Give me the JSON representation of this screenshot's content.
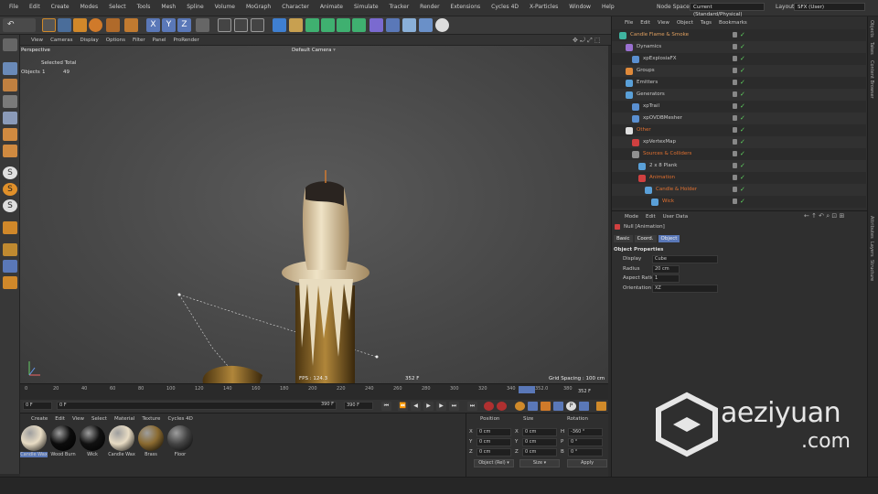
{
  "menu": [
    "File",
    "Edit",
    "Create",
    "Modes",
    "Select",
    "Tools",
    "Mesh",
    "Spline",
    "Volume",
    "MoGraph",
    "Character",
    "Animate",
    "Simulate",
    "Tracker",
    "Render",
    "Extensions",
    "Cycles 4D",
    "X-Particles",
    "Window",
    "Help"
  ],
  "node_space": {
    "label": "Node Space:",
    "value": "Current (Standard/Physical)"
  },
  "layout": {
    "label": "Layout:",
    "value": "SFX (User)"
  },
  "viewport": {
    "menu": [
      "View",
      "Cameras",
      "Display",
      "Options",
      "Filter",
      "Panel",
      "ProRender"
    ],
    "name": "Perspective",
    "camera": "Default Camera",
    "stats": {
      "header": "Selected Total",
      "row_label": "Objects",
      "selected": "1",
      "total": "49"
    },
    "fps": "FPS : 124.3",
    "frame": "352 F",
    "grid": "Grid Spacing : 100 cm"
  },
  "timeline": {
    "ticks": [
      "0",
      "20",
      "40",
      "60",
      "80",
      "100",
      "120",
      "140",
      "160",
      "180",
      "200",
      "220",
      "240",
      "260",
      "280",
      "300",
      "320",
      "340",
      "352.0",
      "380"
    ],
    "end_label": "352 F",
    "current": "352.0"
  },
  "transport": {
    "start": "0 F",
    "start2": "0 F",
    "end": "390 F",
    "end2": "390 F"
  },
  "materials": {
    "menu": [
      "Create",
      "Edit",
      "View",
      "Select",
      "Material",
      "Texture",
      "Cycles 4D"
    ],
    "items": [
      {
        "name": "Candle Wax",
        "color": "#e8dcc4"
      },
      {
        "name": "Wood Burn",
        "color": "#0c0c0c"
      },
      {
        "name": "Wick",
        "color": "#111111"
      },
      {
        "name": "Candle Wax",
        "color": "#e8dcc4"
      },
      {
        "name": "Brass",
        "color": "#8a6a30"
      },
      {
        "name": "Floor",
        "color": "#444444"
      }
    ]
  },
  "coords": {
    "headers": [
      "Position",
      "Size",
      "Rotation"
    ],
    "rows": [
      {
        "a": "X",
        "av": "0 cm",
        "b": "X",
        "bv": "0 cm",
        "c": "H",
        "cv": "-360 °"
      },
      {
        "a": "Y",
        "av": "0 cm",
        "b": "Y",
        "bv": "0 cm",
        "c": "P",
        "cv": "0 °"
      },
      {
        "a": "Z",
        "av": "0 cm",
        "b": "Z",
        "bv": "0 cm",
        "c": "B",
        "cv": "0 °"
      }
    ],
    "mode": "Object (Rel)",
    "size_mode": "Size",
    "apply": "Apply"
  },
  "object_manager": {
    "menu": [
      "File",
      "Edit",
      "View",
      "Object",
      "Tags",
      "Bookmarks"
    ],
    "objects": [
      {
        "name": "Candle Flame & Smoke",
        "color": "#e0a060",
        "icon": "#3fb3a0",
        "indent": 0
      },
      {
        "name": "Dynamics",
        "color": "#c8c8c8",
        "icon": "#9a70d0",
        "indent": 1
      },
      {
        "name": "xpExplosiaFX",
        "color": "#c8c8c8",
        "icon": "#5a8fd0",
        "indent": 2
      },
      {
        "name": "Groups",
        "color": "#c8c8c8",
        "icon": "#e08a3a",
        "indent": 1
      },
      {
        "name": "Emitters",
        "color": "#c8c8c8",
        "icon": "#5aa0d8",
        "indent": 1
      },
      {
        "name": "Generators",
        "color": "#c8c8c8",
        "icon": "#5aa0d8",
        "indent": 1
      },
      {
        "name": "xpTrail",
        "color": "#c8c8c8",
        "icon": "#5a8fd0",
        "indent": 2
      },
      {
        "name": "xpOVDBMesher",
        "color": "#c8c8c8",
        "icon": "#5a8fd0",
        "indent": 2
      },
      {
        "name": "Other",
        "color": "#e07030",
        "icon": "#e0e0e0",
        "indent": 1
      },
      {
        "name": "xpVertexMap",
        "color": "#c8c8c8",
        "icon": "#d04040",
        "indent": 2
      },
      {
        "name": "Sources & Colliders",
        "color": "#e07030",
        "icon": "#909090",
        "indent": 2
      },
      {
        "name": "2 x 8 Plank",
        "color": "#c8c8c8",
        "icon": "#5aa0d8",
        "indent": 3
      },
      {
        "name": "Animation",
        "color": "#e07030",
        "icon": "#d04040",
        "indent": 3
      },
      {
        "name": "Candle & Holder",
        "color": "#e07030",
        "icon": "#5aa0d8",
        "indent": 4
      },
      {
        "name": "Wick",
        "color": "#e07030",
        "icon": "#5aa0d8",
        "indent": 5
      }
    ]
  },
  "attributes": {
    "menu": [
      "Mode",
      "Edit",
      "User Data"
    ],
    "title": "Null [Animation]",
    "tabs": [
      "Basic",
      "Coord.",
      "Object"
    ],
    "section": "Object Properties",
    "props": [
      {
        "label": "Display",
        "value": "Cube",
        "type": "select"
      },
      {
        "label": "Radius",
        "value": "20 cm",
        "type": "field"
      },
      {
        "label": "Aspect Ratio",
        "value": "1",
        "type": "field"
      },
      {
        "label": "Orientation",
        "value": "XZ",
        "type": "select"
      }
    ]
  },
  "side_tabs": {
    "top": [
      "Objects",
      "Takes",
      "Content Browser"
    ],
    "bottom": [
      "Attributes",
      "Layers",
      "Structure"
    ]
  },
  "watermark": {
    "brand": "aeziyuan",
    "domain": ".com"
  }
}
